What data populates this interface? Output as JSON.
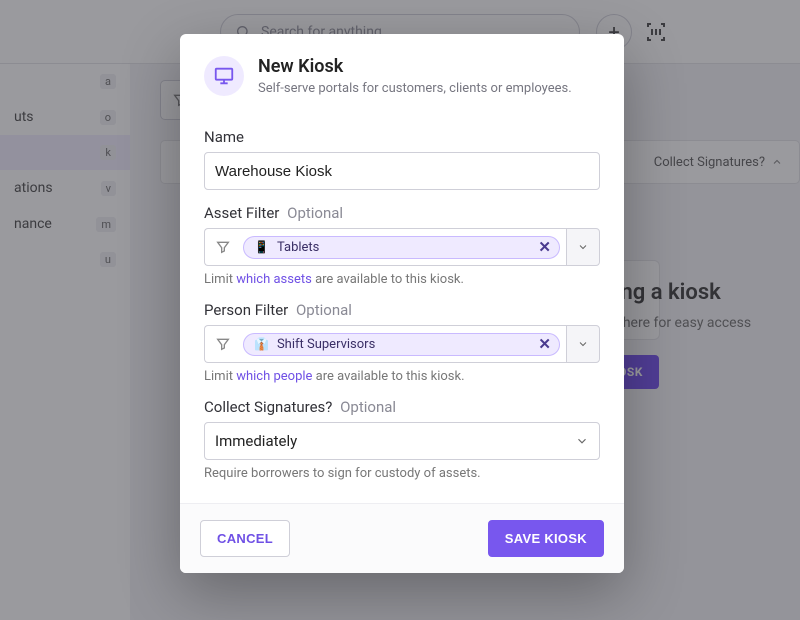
{
  "topbar": {
    "search_placeholder": "Search for anything"
  },
  "sidebar": {
    "items": [
      {
        "label": "",
        "key": "a"
      },
      {
        "label": "uts",
        "key": "o"
      },
      {
        "label": "",
        "key": "k"
      },
      {
        "label": "ations",
        "key": "v"
      },
      {
        "label": "nance",
        "key": "m"
      },
      {
        "label": "",
        "key": "u"
      }
    ]
  },
  "page": {
    "column_header": "Collect Signatures?",
    "hero_title_prefix": "dding a kiosk",
    "hero_sub": "ayed here for easy access",
    "new_kiosk_btn": "KIOSK"
  },
  "modal": {
    "title": "New Kiosk",
    "subtitle": "Self-serve portals for customers, clients or employees.",
    "name": {
      "label": "Name",
      "value": "Warehouse Kiosk"
    },
    "asset_filter": {
      "label": "Asset Filter",
      "optional": "Optional",
      "chip": "Tablets",
      "hint_pre": "Limit ",
      "hint_link": "which assets",
      "hint_post": " are available to this kiosk."
    },
    "person_filter": {
      "label": "Person Filter",
      "optional": "Optional",
      "chip": "Shift Supervisors",
      "hint_pre": "Limit ",
      "hint_link": "which people",
      "hint_post": " are available to this kiosk."
    },
    "collect": {
      "label": "Collect Signatures?",
      "optional": "Optional",
      "value": "Immediately",
      "hint": "Require borrowers to sign for custody of assets."
    },
    "buttons": {
      "cancel": "CANCEL",
      "save": "SAVE KIOSK"
    }
  }
}
